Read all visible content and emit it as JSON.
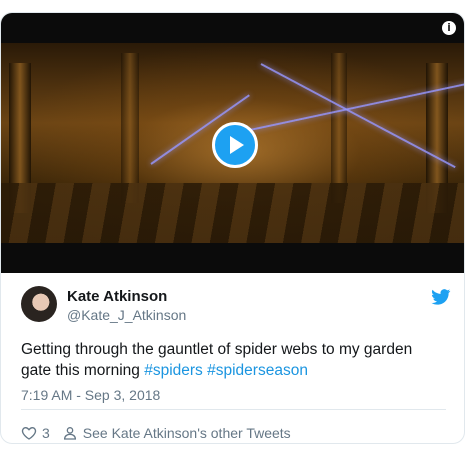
{
  "media": {
    "info_icon": "info-icon",
    "play_icon": "play-icon",
    "accent_color": "#1da1f2"
  },
  "author": {
    "name": "Kate Atkinson",
    "handle": "@Kate_J_Atkinson",
    "avatar": "avatar",
    "platform_icon": "twitter-bird-icon"
  },
  "tweet": {
    "text_before": "Getting through the gauntlet of spider webs to my garden gate this morning ",
    "hashtags": [
      "#spiders",
      "#spiderseason"
    ],
    "timestamp": "7:19 AM - Sep 3, 2018",
    "hashtag_color": "#1b95e0"
  },
  "actions": {
    "like_count": "3",
    "other_tweets_label": "See Kate Atkinson's other Tweets",
    "like_icon": "heart-icon",
    "profile_icon": "person-icon"
  }
}
